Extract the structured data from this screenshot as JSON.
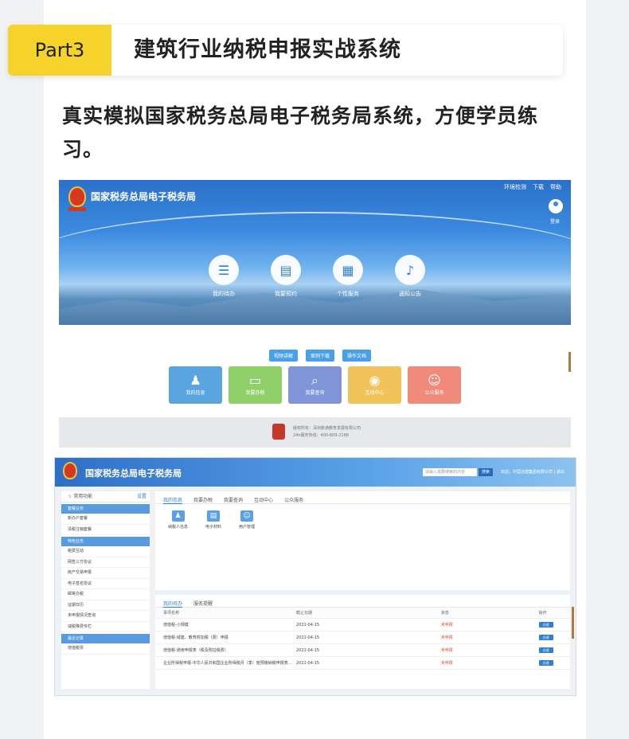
{
  "part": {
    "badge": "Part3",
    "title": "建筑行业纳税申报实战系统"
  },
  "intro": "真实模拟国家税务总局电子税务局系统，方便学员练习。",
  "shot1": {
    "site_title": "国家税务总局电子税务局",
    "top_links": [
      "环境检测",
      "下载",
      "帮助"
    ],
    "login": "登录",
    "banner_items": [
      {
        "label": "我的待办",
        "icon": "document-icon"
      },
      {
        "label": "我要预约",
        "icon": "calendar-icon"
      },
      {
        "label": "个性服务",
        "icon": "grid-icon"
      },
      {
        "label": "通知公告",
        "icon": "bell-icon"
      }
    ],
    "pills": [
      "视频讲解",
      "案例下载",
      "操作文档"
    ],
    "tiles": [
      {
        "label": "我的信息",
        "color": "#5aa5e0"
      },
      {
        "label": "我要办税",
        "color": "#8fd06a"
      },
      {
        "label": "我要查询",
        "color": "#7f95d8"
      },
      {
        "label": "互动中心",
        "color": "#f0c45a"
      },
      {
        "label": "公众服务",
        "color": "#f08a7a"
      }
    ],
    "footer": [
      "版权所有：深圳账通教育发展有限公司",
      "24h服务热线：400-809-2188"
    ]
  },
  "shot2": {
    "site_title": "国家税务总局电子税务局",
    "search_placeholder": "请输入需要搜索的内容",
    "search_btn": "搜索",
    "user": "欢迎，中国冶建集团有限公司  |  退出",
    "side_header": "常用功能",
    "side_setting": "设置",
    "sections": [
      {
        "title": "套餐业务",
        "items": [
          "新办户套餐",
          "清税注销套餐"
        ]
      },
      {
        "title": "特色业务",
        "items": [
          "税费互动",
          "网签三方协议",
          "房产交易申报",
          "电子签名协议",
          "邮寄办税",
          "征期日历",
          "未申报情况查询",
          "减税降费专栏"
        ]
      },
      {
        "title": "最近记录",
        "items": [
          "增值税票"
        ]
      }
    ],
    "main_tabs": [
      "我的信息",
      "我要办税",
      "我要查询",
      "互动中心",
      "公众服务"
    ],
    "apps": [
      "纳税人信息",
      "电子材料",
      "用户管理"
    ],
    "todo_tabs": [
      "我的待办",
      "服务提醒"
    ],
    "todo_headers": [
      "事项名称",
      "截止日期",
      "状态",
      "操作"
    ],
    "todo_rows": [
      {
        "name": "增值税-小规模",
        "date": "2021-04-15",
        "status": "未申报",
        "op": "办理"
      },
      {
        "name": "增值税-城建、教育附加税（费）申报",
        "date": "2021-04-15",
        "status": "未申报",
        "op": "办理"
      },
      {
        "name": "增值税-通用申报表（税及附征税费）",
        "date": "2021-04-15",
        "status": "未申报",
        "op": "办理"
      },
      {
        "name": "企业所得税申报-中华人民共和国企业所得税月（季）度预缴纳税申报表...",
        "date": "2021-04-15",
        "status": "未申报",
        "op": "办理"
      }
    ]
  }
}
